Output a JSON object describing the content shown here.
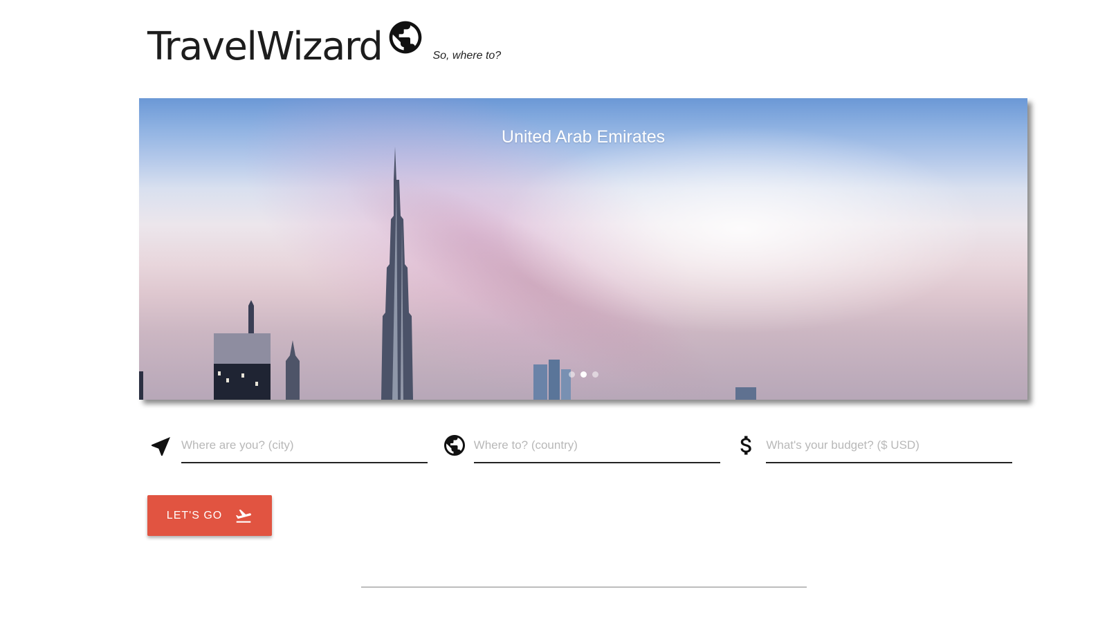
{
  "header": {
    "title": "TravelWizard",
    "logo_icon": "globe-icon",
    "tagline": "So, where to?"
  },
  "carousel": {
    "caption": "United Arab Emirates",
    "slide_count": 3,
    "active_index": 1
  },
  "form": {
    "origin": {
      "icon": "navigation-arrow-icon",
      "placeholder": "Where are you? (city)",
      "value": ""
    },
    "destination": {
      "icon": "globe-icon",
      "placeholder": "Where to? (country)",
      "value": ""
    },
    "budget": {
      "icon": "dollar-icon",
      "placeholder": "What's your budget? ($ USD)",
      "value": ""
    }
  },
  "submit": {
    "label": "LET'S GO",
    "icon": "flight-takeoff-icon",
    "color": "#e15441"
  }
}
